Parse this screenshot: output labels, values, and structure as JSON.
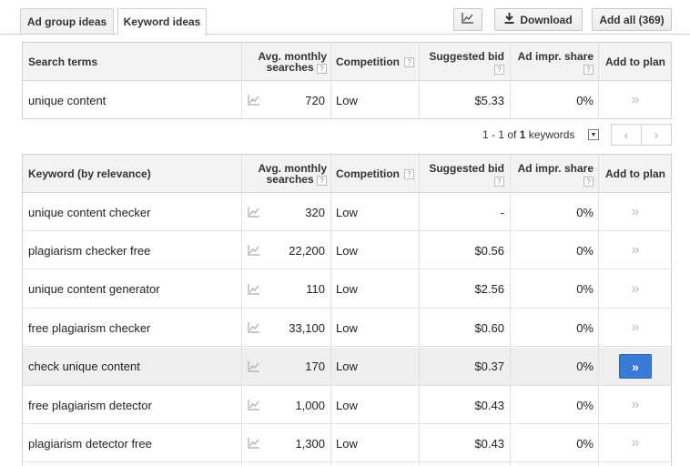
{
  "tabs": [
    {
      "label": "Ad group ideas",
      "active": false
    },
    {
      "label": "Keyword ideas",
      "active": true
    }
  ],
  "toolbar": {
    "chart_icon": "line-chart-icon",
    "download_label": "Download",
    "add_all_label": "Add all (369)"
  },
  "search_table": {
    "headers": {
      "term": "Search terms",
      "avg": "Avg. monthly searches",
      "competition": "Competition",
      "bid": "Suggested bid",
      "share": "Ad impr. share",
      "add": "Add to plan"
    },
    "rows": [
      {
        "term": "unique content",
        "avg": "720",
        "competition": "Low",
        "bid": "$5.33",
        "share": "0%"
      }
    ]
  },
  "pagination": {
    "text_prefix": "1 - 1 of ",
    "total": "1",
    "text_suffix": " keywords"
  },
  "keyword_table": {
    "headers": {
      "term": "Keyword (by relevance)",
      "avg": "Avg. monthly searches",
      "competition": "Competition",
      "bid": "Suggested bid",
      "share": "Ad impr. share",
      "add": "Add to plan"
    },
    "rows": [
      {
        "term": "unique content checker",
        "avg": "320",
        "competition": "Low",
        "bid": "-",
        "share": "0%"
      },
      {
        "term": "plagiarism checker free",
        "avg": "22,200",
        "competition": "Low",
        "bid": "$0.56",
        "share": "0%"
      },
      {
        "term": "unique content generator",
        "avg": "110",
        "competition": "Low",
        "bid": "$2.56",
        "share": "0%"
      },
      {
        "term": "free plagiarism checker",
        "avg": "33,100",
        "competition": "Low",
        "bid": "$0.60",
        "share": "0%"
      },
      {
        "term": "check unique content",
        "avg": "170",
        "competition": "Low",
        "bid": "$0.37",
        "share": "0%"
      },
      {
        "term": "free plagiarism detector",
        "avg": "1,000",
        "competition": "Low",
        "bid": "$0.43",
        "share": "0%"
      },
      {
        "term": "plagiarism detector free",
        "avg": "1,300",
        "competition": "Low",
        "bid": "$0.43",
        "share": "0%"
      }
    ]
  },
  "colors": {
    "accent": "#3a7bd5",
    "header_bg": "#f3f3f3",
    "highlight_row": "#efefef"
  }
}
